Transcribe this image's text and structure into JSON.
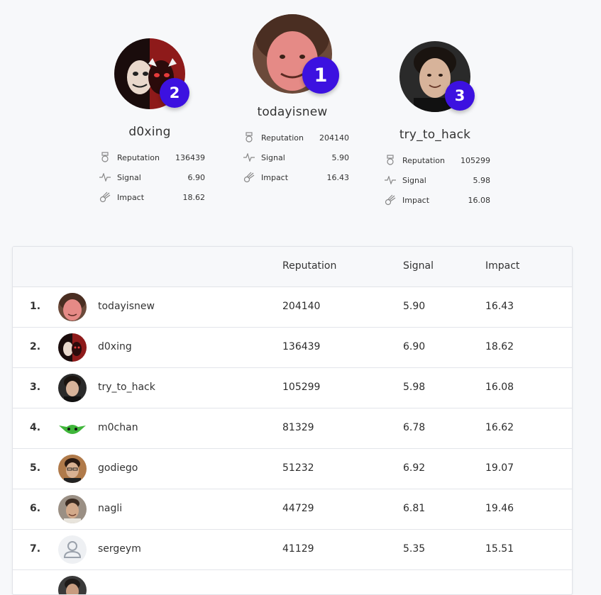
{
  "podium": [
    {
      "place": "1",
      "name": "todayisnew",
      "avatar": "curly-hair-man-photo",
      "stats": {
        "reputation": "204140",
        "signal": "5.90",
        "impact": "16.43"
      }
    },
    {
      "place": "2",
      "name": "d0xing",
      "avatar": "masked-villain-photo",
      "stats": {
        "reputation": "136439",
        "signal": "6.90",
        "impact": "18.62"
      }
    },
    {
      "place": "3",
      "name": "try_to_hack",
      "avatar": "young-man-photo",
      "stats": {
        "reputation": "105299",
        "signal": "5.98",
        "impact": "16.08"
      }
    }
  ],
  "stat_labels": {
    "reputation": "Reputation",
    "signal": "Signal",
    "impact": "Impact"
  },
  "table": {
    "headers": {
      "reputation": "Reputation",
      "signal": "Signal",
      "impact": "Impact"
    },
    "rows": [
      {
        "rank": "1.",
        "name": "todayisnew",
        "reputation": "204140",
        "signal": "5.90",
        "impact": "16.43",
        "avatar": "curly-hair-man-photo"
      },
      {
        "rank": "2.",
        "name": "d0xing",
        "reputation": "136439",
        "signal": "6.90",
        "impact": "18.62",
        "avatar": "masked-villain-photo"
      },
      {
        "rank": "3.",
        "name": "try_to_hack",
        "reputation": "105299",
        "signal": "5.98",
        "impact": "16.08",
        "avatar": "young-man-photo"
      },
      {
        "rank": "4.",
        "name": "m0chan",
        "reputation": "81329",
        "signal": "6.78",
        "impact": "16.62",
        "avatar": "green-alien-icon"
      },
      {
        "rank": "5.",
        "name": "godiego",
        "reputation": "51232",
        "signal": "6.92",
        "impact": "19.07",
        "avatar": "man-with-glasses-photo"
      },
      {
        "rank": "6.",
        "name": "nagli",
        "reputation": "44729",
        "signal": "6.81",
        "impact": "19.46",
        "avatar": "smiling-man-photo"
      },
      {
        "rank": "7.",
        "name": "sergeym",
        "reputation": "41129",
        "signal": "5.35",
        "impact": "15.51",
        "avatar": "default-user-icon"
      }
    ]
  },
  "colors": {
    "badge": "#3c11e0",
    "background": "#f7f8fa"
  }
}
